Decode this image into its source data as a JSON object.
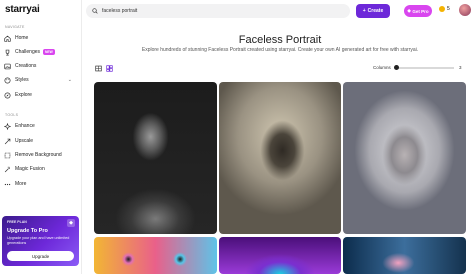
{
  "app": {
    "logo": "starryai"
  },
  "sidebar": {
    "navigate_label": "NAVIGATE",
    "nav_items": [
      {
        "label": "Home",
        "icon": "home-icon"
      },
      {
        "label": "Challenges",
        "icon": "trophy-icon",
        "badge": "NEW"
      },
      {
        "label": "Creations",
        "icon": "image-icon"
      },
      {
        "label": "Styles",
        "icon": "palette-icon"
      },
      {
        "label": "Explore",
        "icon": "compass-icon"
      }
    ],
    "tools_label": "TOOLS",
    "tool_items": [
      {
        "label": "Enhance",
        "icon": "sparkle-icon"
      },
      {
        "label": "Upscale",
        "icon": "upscale-icon"
      },
      {
        "label": "Remove Background",
        "icon": "erase-icon"
      },
      {
        "label": "Magic Fusion",
        "icon": "magic-icon"
      },
      {
        "label": "More",
        "icon": "more-icon"
      }
    ],
    "upgrade": {
      "plan": "FREE PLAN",
      "title": "Upgrade To Pro",
      "description": "Upgrade your plan and have unlimited generations",
      "button": "Upgrade"
    }
  },
  "topbar": {
    "search_value": "faceless portrait",
    "create_label": "Create",
    "get_pro_label": "Get Pro",
    "coins": "5"
  },
  "main": {
    "title": "Faceless Portrait",
    "subtitle": "Explore hundreds of stunning Faceless Portrait created using starryai. Create your own AI generated art for free with starryai.",
    "columns_label": "Columns",
    "columns_value": "3",
    "columns_fraction": 0.0
  },
  "colors": {
    "accent": "#6d28d9",
    "pro": "#d946ef"
  }
}
